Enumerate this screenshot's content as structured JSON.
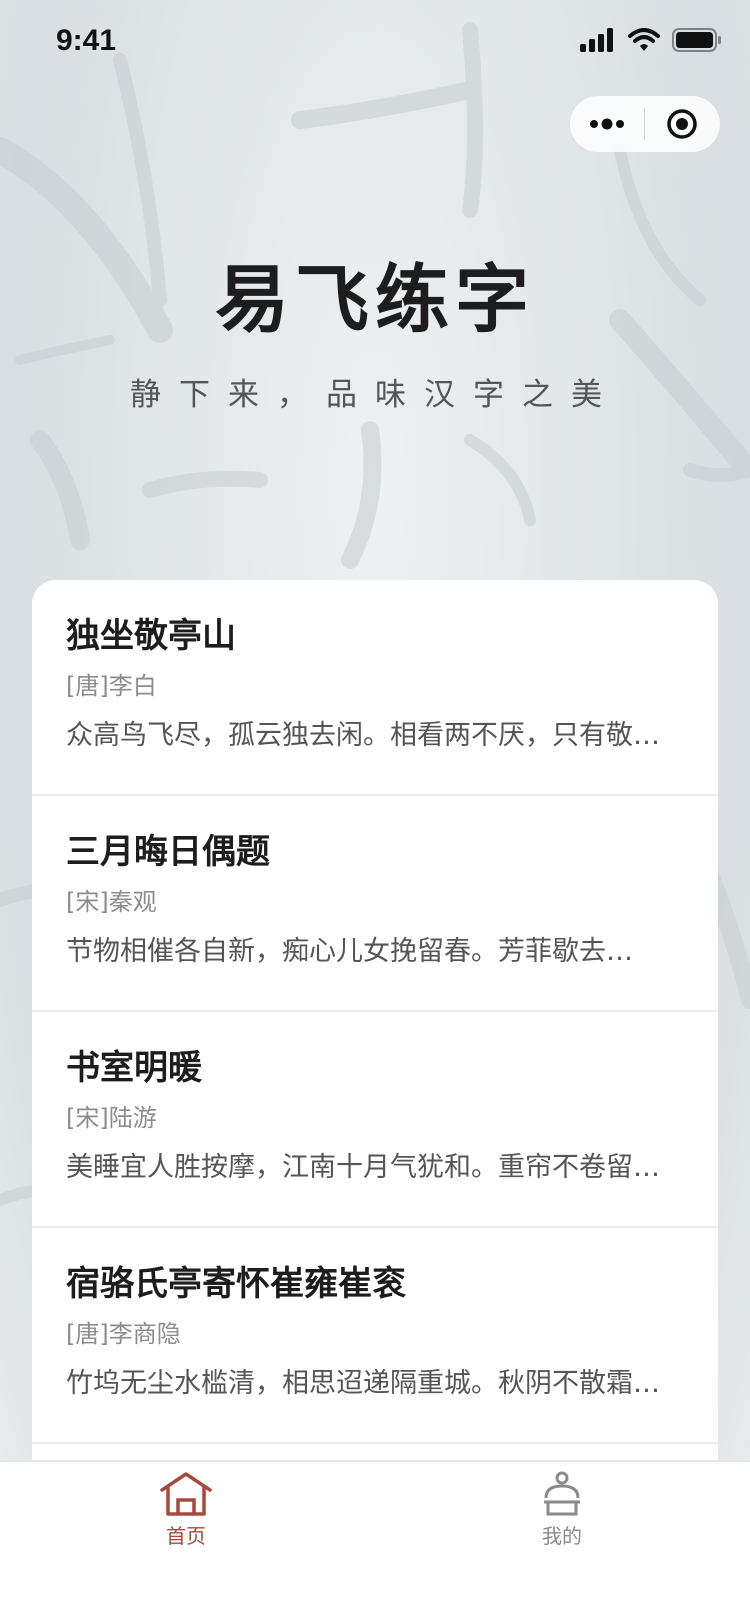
{
  "status_bar": {
    "time": "9:41"
  },
  "capsule": {
    "more_icon": "more-dots-icon",
    "close_icon": "target-circle-icon"
  },
  "hero": {
    "title": "易飞练字",
    "subtitle": "静下来，品味汉字之美"
  },
  "poems": [
    {
      "title": "独坐敬亭山",
      "author": "[唐]李白",
      "excerpt": "众高鸟飞尽，孤云独去闲。相看两不厌，只有敬…"
    },
    {
      "title": "三月晦日偶题",
      "author": "[宋]秦观",
      "excerpt": "节物相催各自新，痴心儿女挽留春。芳菲歇去…"
    },
    {
      "title": "书室明暖",
      "author": "[宋]陆游",
      "excerpt": "美睡宜人胜按摩，江南十月气犹和。重帘不卷留…"
    },
    {
      "title": "宿骆氏亭寄怀崔雍崔衮",
      "author": "[唐]李商隐",
      "excerpt": "竹坞无尘水槛清，相思迢递隔重城。秋阴不散霜…"
    }
  ],
  "tabbar": {
    "items": [
      {
        "label": "首页",
        "icon": "home-icon",
        "active": true
      },
      {
        "label": "我的",
        "icon": "person-icon",
        "active": false
      }
    ]
  },
  "colors": {
    "accent": "#a8493c",
    "inactive": "#8a8a8a",
    "title": "#1d1d1d"
  }
}
